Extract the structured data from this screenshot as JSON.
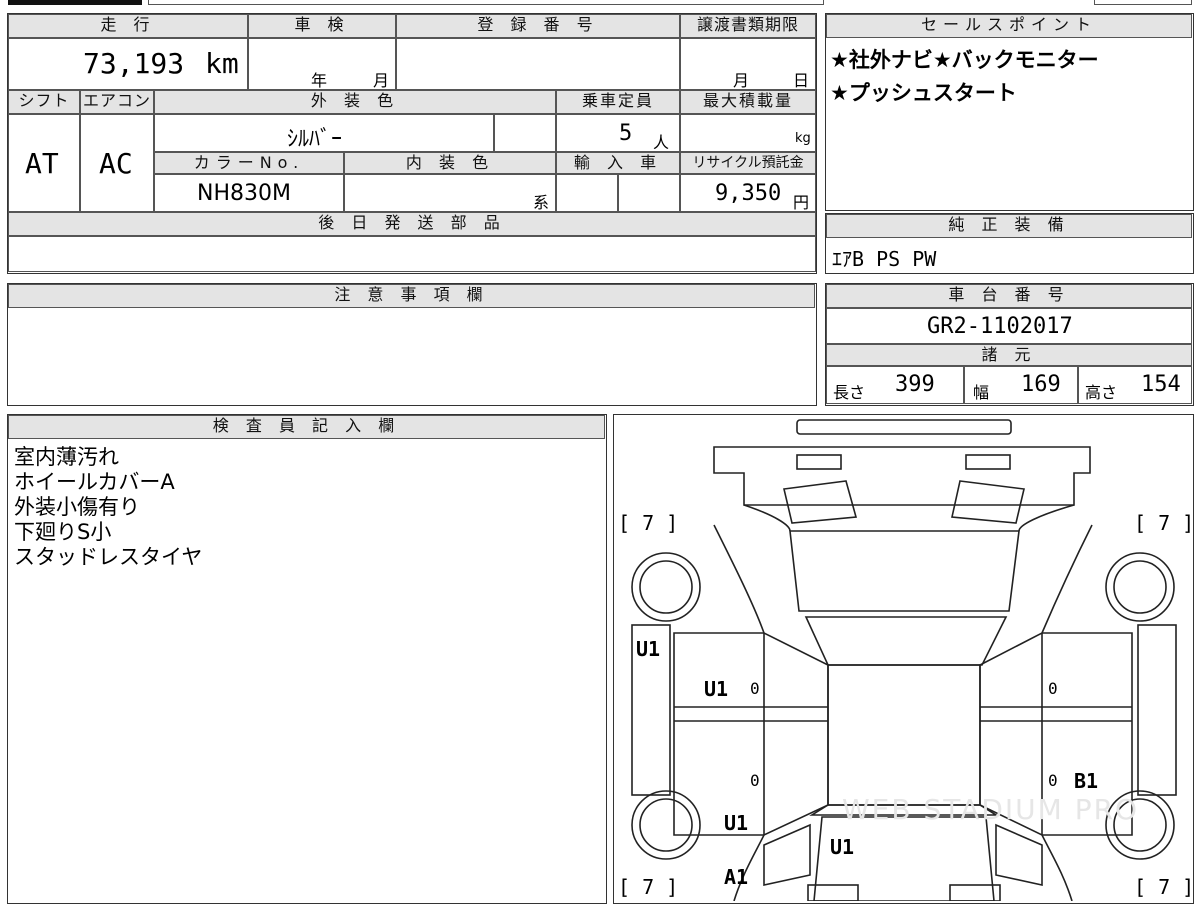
{
  "header": {
    "mileage_label": "走 行",
    "mileage_value": "73,193",
    "mileage_unit": "km",
    "inspection_label": "車 検",
    "inspection_year": "年",
    "inspection_month": "月",
    "registration_label": "登 録 番 号",
    "transfer_label": "譲渡書類期限",
    "transfer_month": "月",
    "transfer_day": "日"
  },
  "specs": {
    "shift_label": "シフト",
    "shift_value": "AT",
    "aircon_label": "エアコン",
    "aircon_value": "AC",
    "exterior_color_label": "外 装 色",
    "exterior_color_value": "ｼﾙﾊﾞｰ",
    "capacity_label": "乗車定員",
    "capacity_value": "5",
    "capacity_unit": "人",
    "max_load_label": "最大積載量",
    "max_load_unit": "kg",
    "color_no_label": "カラーNo.",
    "color_no_value": "NH830M",
    "interior_color_label": "内 装 色",
    "interior_color_unit": "系",
    "import_label": "輸 入 車",
    "recycle_label": "リサイクル預託金",
    "recycle_value": "9,350",
    "recycle_unit": "円"
  },
  "later_parts_label": "後 日 発 送 部 品",
  "sales_points": {
    "label": "セールスポイント",
    "lines": [
      "★社外ナビ★バックモニター",
      "★プッシュスタート"
    ]
  },
  "equipment": {
    "label": "純 正 装 備",
    "value": "ｴｱB PS PW"
  },
  "caution_label": "注 意 事 項 欄",
  "chassis": {
    "label": "車 台 番 号",
    "value": "GR2-1102017"
  },
  "dimensions": {
    "label": "諸 元",
    "length_label": "長さ",
    "length_value": "399",
    "width_label": "幅",
    "width_value": "169",
    "height_label": "高さ",
    "height_value": "154"
  },
  "inspector": {
    "label": "検 査 員 記 入 欄",
    "notes": [
      "室内薄汚れ",
      "ホイールカバーA",
      "外装小傷有り",
      "下廻りS小",
      "スタッドレスタイヤ"
    ]
  },
  "diagram": {
    "tire_tl": "[ 7 ]",
    "tire_tr": "[ 7 ]",
    "tire_bl": "[ 7 ]",
    "tire_br": "[ 7 ]",
    "marks": {
      "left_fender": "U1",
      "left_front_door": "U1",
      "lf_door_glass": "0",
      "rf_door_glass": "0",
      "lr_door_glass": "0",
      "rr_door_glass": "0",
      "right_rear_door": "B1",
      "left_rear_quarter": "U1",
      "left_rear_lower": "A1",
      "rear_center": "U1"
    },
    "watermark": "WEB STADIUM PRO"
  }
}
